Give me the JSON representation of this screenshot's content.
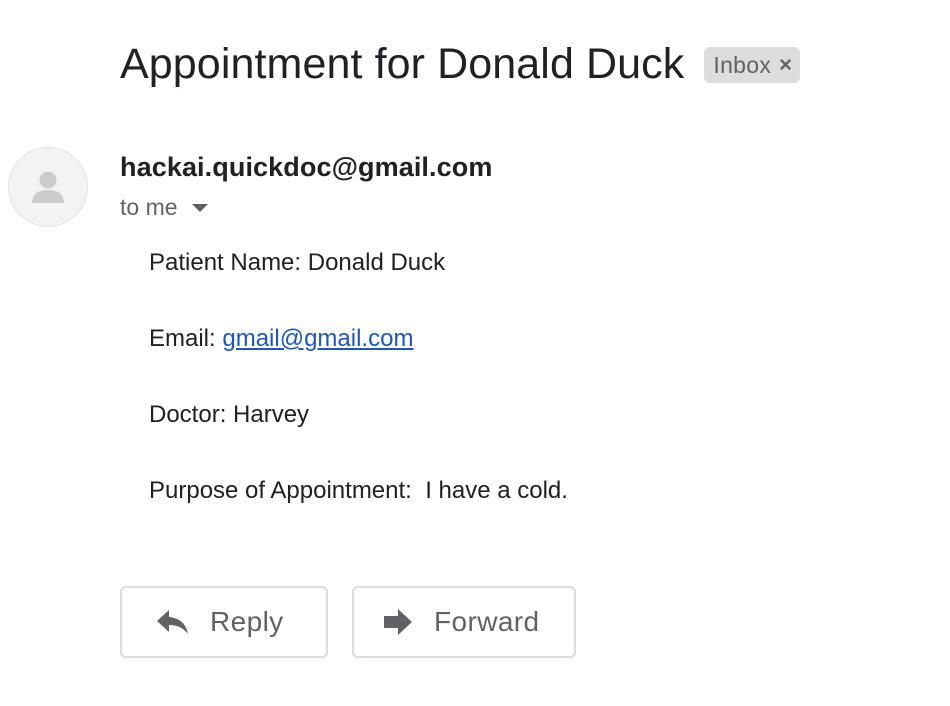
{
  "email": {
    "subject": "Appointment for Donald Duck",
    "label": "Inbox",
    "label_close": "×",
    "sender": "hackai.quickdoc@gmail.com",
    "recipient": "to me",
    "body": {
      "patient_prefix": "Patient Name: ",
      "patient_name": "Donald Duck",
      "email_prefix": "Email: ",
      "email_value": "gmail@gmail.com",
      "doctor_prefix": "Doctor: ",
      "doctor_name": "Harvey",
      "purpose_prefix": "Purpose of Appointment:  ",
      "purpose_value": "I have a cold."
    }
  },
  "actions": {
    "reply_label": "Reply",
    "forward_label": "Forward"
  },
  "icons": {
    "avatar": "person-icon",
    "reply": "reply-arrow-icon",
    "forward": "forward-arrow-icon",
    "recipient_caret": "caret-down-icon",
    "label_close": "close-icon"
  },
  "colors": {
    "text": "#202124",
    "muted": "#5f6368",
    "link": "#1a57c2",
    "chip_bg": "#dddddd",
    "border": "#dadce0"
  }
}
